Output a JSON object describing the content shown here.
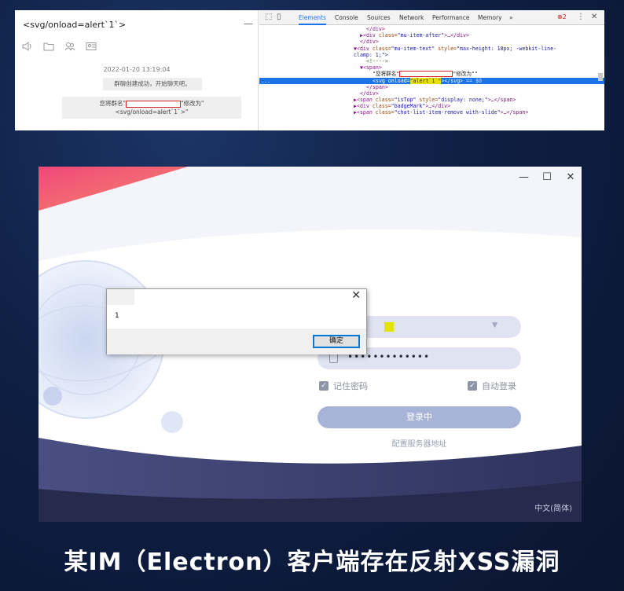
{
  "chat": {
    "title": "<svg/onload=alert`1`>",
    "minimize": "—",
    "time": "2022-01-20 13:19:04",
    "system_msg": "群聊创建成功，开始聊天吧。",
    "rename_prefix": "您将群名\"",
    "rename_suffix": "\"修改为\"",
    "rename_value": "<svg/onload=alert`1`>\""
  },
  "devtools": {
    "tabs": [
      "Elements",
      "Console",
      "Sources",
      "Network",
      "Performance",
      "Memory",
      "»"
    ],
    "active_tab": "Elements",
    "error_count": "2",
    "lines": {
      "l1": "</div>",
      "l2a": "▶<div ",
      "l2b": "class=",
      "l2c": "\"mu-item-after\"",
      "l2d": ">…</div>",
      "l3": "</div>",
      "l4a": "▼<div ",
      "l4b": "class=",
      "l4c": "\"mu-item-text\"",
      "l4d": " style=",
      "l4e": "\"max-height: 18px; -webkit-line-",
      "l5": "clamp: 1;\">",
      "l6": "<!---->",
      "l7": "▼<span>",
      "l8a": "\"您将群名\"",
      "l8b": "\"修改为\"\"",
      "l9a": "<svg onload=",
      "l9b": "\"alert`1`\"",
      "l9c": "></svg>",
      "l9d": " == $0",
      "l9m": "...",
      "l10": "</span>",
      "l11": "</div>",
      "l12a": "▶<span ",
      "l12b": "class=",
      "l12c": "\"isTop\"",
      "l12d": " style=",
      "l12e": "\"display: none;\"",
      "l12f": ">…</span>",
      "l13a": "▶<div ",
      "l13b": "class=",
      "l13c": "\"badgeMark\"",
      "l13d": ">…</div>",
      "l14a": "▶<span ",
      "l14b": "class=",
      "l14c": "\"chat-list-item-remove with-slide\"",
      "l14d": ">…</span>"
    }
  },
  "login": {
    "window_controls": {
      "minimize": "—",
      "maximize": "☐",
      "close": "✕"
    },
    "password_dots": "•••••••••••••",
    "remember_password": "记住密码",
    "auto_login": "自动登录",
    "login_button": "登录中",
    "server_config": "配置服务器地址",
    "language": "中文(简体)"
  },
  "alert": {
    "message": "1",
    "ok_button": "确定",
    "close": "✕"
  },
  "caption": "某IM（Electron）客户端存在反射XSS漏洞",
  "colors": {
    "background": "#0f1f44",
    "accent_blue": "#1a73e8",
    "redact_red": "#d32020",
    "login_button": "#a7b4d8"
  }
}
